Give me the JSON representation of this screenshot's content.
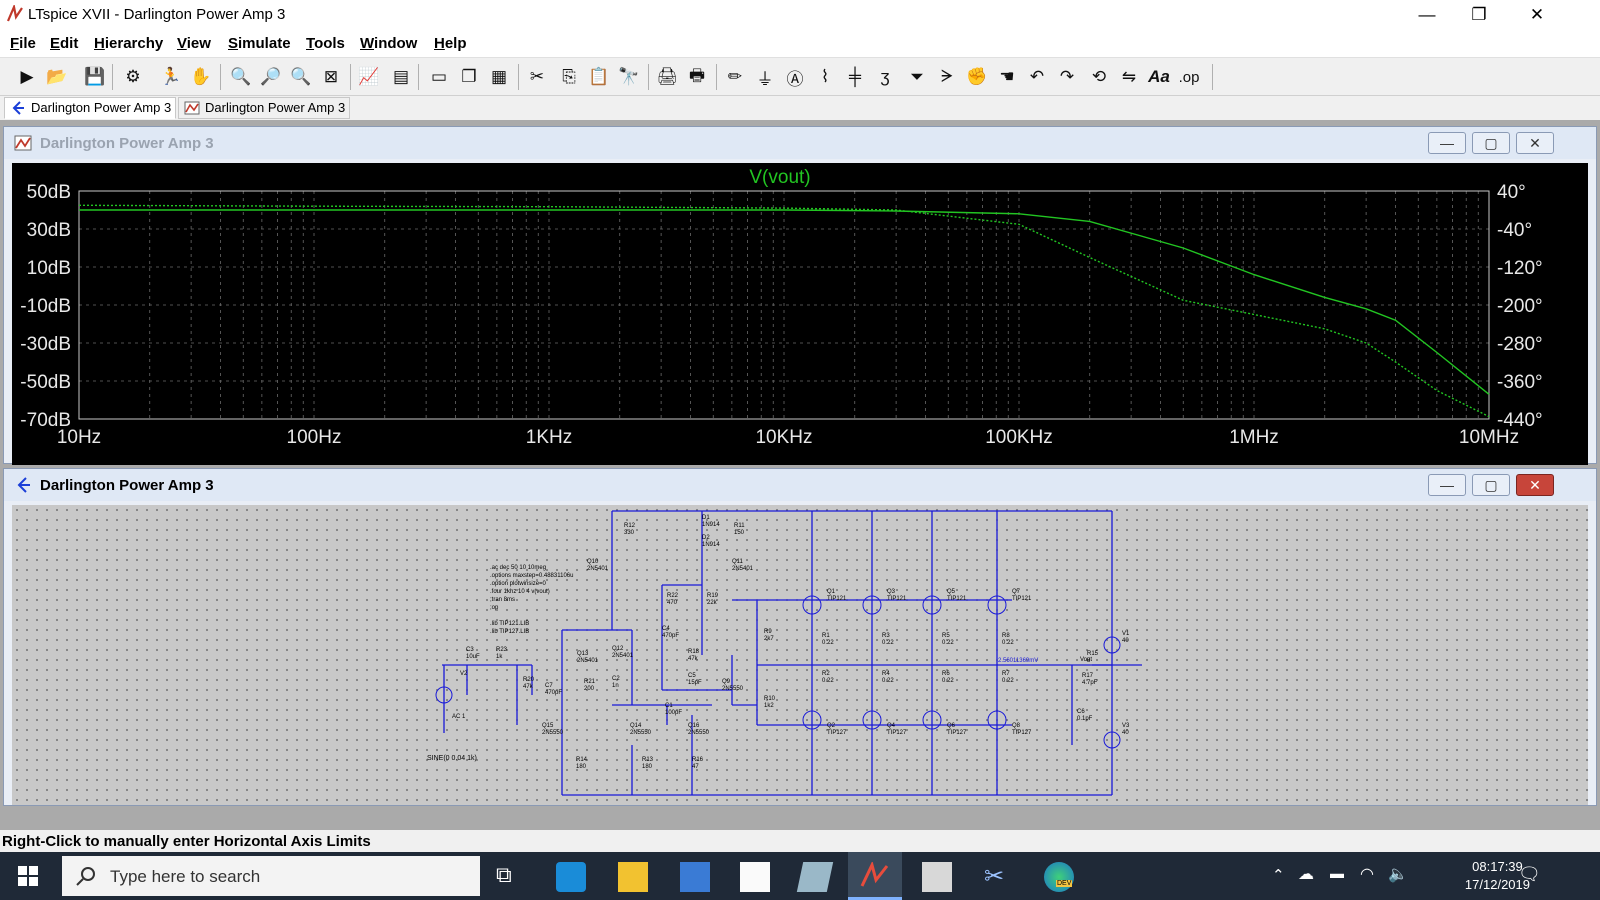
{
  "window": {
    "title": "LTspice XVII - Darlington Power Amp 3",
    "minimize": "—",
    "maximize": "❐",
    "close": "✕"
  },
  "menu": [
    {
      "ul": "F",
      "rest": "ile"
    },
    {
      "ul": "E",
      "rest": "dit"
    },
    {
      "ul": "H",
      "rest": "ierarchy"
    },
    {
      "ul": "V",
      "rest": "iew"
    },
    {
      "ul": "S",
      "rest": "imulate"
    },
    {
      "ul": "T",
      "rest": "ools"
    },
    {
      "ul": "W",
      "rest": "indow"
    },
    {
      "ul": "H",
      "rest": "elp"
    }
  ],
  "toolbar": {
    "font_button": "Aa",
    "op_button": ".op"
  },
  "tabs": [
    {
      "label": "Darlington Power Amp 3"
    },
    {
      "label": "Darlington Power Amp 3"
    }
  ],
  "plot_window": {
    "title": "Darlington Power Amp 3"
  },
  "schematic_window": {
    "title": "Darlington Power Amp 3"
  },
  "chart_data": {
    "type": "line",
    "title": "V(vout)",
    "x_scale": "log",
    "x_ticks": [
      "10Hz",
      "100Hz",
      "1KHz",
      "10KHz",
      "100KHz",
      "1MHz",
      "10MHz"
    ],
    "y_left_ticks": [
      "50dB",
      "30dB",
      "10dB",
      "-10dB",
      "-30dB",
      "-50dB",
      "-70dB"
    ],
    "y_right_ticks": [
      "40°",
      "-40°",
      "-120°",
      "-200°",
      "-280°",
      "-360°",
      "-440°"
    ],
    "xlim": [
      10,
      10000000
    ],
    "ylim_db": [
      -70,
      50
    ],
    "ylim_phase": [
      -440,
      40
    ],
    "grid": true,
    "series": [
      {
        "name": "V(vout)",
        "axis": "magnitude",
        "style": "solid",
        "color": "#22c522",
        "x": [
          10,
          100,
          1000,
          10000,
          30000,
          100000,
          200000,
          500000,
          1000000,
          2000000,
          3000000,
          4000000,
          6000000,
          10000000
        ],
        "y": [
          40,
          40,
          40,
          40,
          39.5,
          38,
          34,
          20,
          6,
          -6,
          -12,
          -18,
          -35,
          -57
        ]
      },
      {
        "name": "V(vout) phase",
        "axis": "phase",
        "style": "dotted",
        "color": "#22c522",
        "x": [
          10,
          100,
          1000,
          10000,
          30000,
          100000,
          200000,
          500000,
          1000000,
          2000000,
          3000000,
          4000000,
          6000000,
          10000000
        ],
        "y": [
          10,
          8,
          7,
          4,
          0,
          -30,
          -100,
          -190,
          -220,
          -250,
          -280,
          -320,
          -380,
          -435
        ]
      }
    ]
  },
  "schematic": {
    "directives": [
      ".ac dec 50 10 10meg",
      ".options maxstep=0.48831106u",
      ".option plotwinsize=0",
      ".four 1khz 10 4 v(vout)",
      ";tran 8ms",
      ";op",
      ".lib TIP121.LIB",
      ".lib TIP127.LIB"
    ],
    "source_label": "SINE(0 0.04 1k)",
    "ac_label": "AC 1",
    "vout_label": "Vout",
    "node_voltage": "2.56011369mV",
    "labels": [
      {
        "t": "R12",
        "v": "330"
      },
      {
        "t": "R11",
        "v": "150"
      },
      {
        "t": "D1",
        "v": "1N914"
      },
      {
        "t": "D2",
        "v": "1N914"
      },
      {
        "t": "Q10",
        "v": "2N5401"
      },
      {
        "t": "Q11",
        "v": "2N5401"
      },
      {
        "t": "R22",
        "v": "470"
      },
      {
        "t": "R19",
        "v": "22k"
      },
      {
        "t": "C4",
        "v": "470pF"
      },
      {
        "t": "R18",
        "v": "47k"
      },
      {
        "t": "C5",
        "v": "15pF"
      },
      {
        "t": "Q9",
        "v": "2N5550"
      },
      {
        "t": "R9",
        "v": "2k7"
      },
      {
        "t": "R10",
        "v": "1k2"
      },
      {
        "t": "Q13",
        "v": "2N5401"
      },
      {
        "t": "Q12",
        "v": "2N5401"
      },
      {
        "t": "R21",
        "v": "200"
      },
      {
        "t": "C2",
        "v": "1n"
      },
      {
        "t": "C3",
        "v": "10uF"
      },
      {
        "t": "R23",
        "v": "1k"
      },
      {
        "t": "R20",
        "v": "47k"
      },
      {
        "t": "C7",
        "v": "470pF"
      },
      {
        "t": "C1",
        "v": "100pF"
      },
      {
        "t": "Q15",
        "v": "2N5550"
      },
      {
        "t": "Q14",
        "v": "2N5550"
      },
      {
        "t": "Q16",
        "v": "2N5550"
      },
      {
        "t": "R14",
        "v": "180"
      },
      {
        "t": "R13",
        "v": "180"
      },
      {
        "t": "R16",
        "v": "47"
      },
      {
        "t": "V2",
        "v": ""
      },
      {
        "t": "Q1",
        "v": "TIP121"
      },
      {
        "t": "Q3",
        "v": "TIP121"
      },
      {
        "t": "Q5",
        "v": "TIP121"
      },
      {
        "t": "Q7",
        "v": "TIP121"
      },
      {
        "t": "R1",
        "v": "0.22"
      },
      {
        "t": "R3",
        "v": "0.22"
      },
      {
        "t": "R5",
        "v": "0.22"
      },
      {
        "t": "R8",
        "v": "0.22"
      },
      {
        "t": "R2",
        "v": "0.22"
      },
      {
        "t": "R4",
        "v": "0.22"
      },
      {
        "t": "R6",
        "v": "0.22"
      },
      {
        "t": "R7",
        "v": "0.22"
      },
      {
        "t": "Q2",
        "v": "TIP127"
      },
      {
        "t": "Q4",
        "v": "TIP127"
      },
      {
        "t": "Q6",
        "v": "TIP127"
      },
      {
        "t": "Q8",
        "v": "TIP127"
      },
      {
        "t": "R15",
        "v": "8"
      },
      {
        "t": "R17",
        "v": "4.7pF"
      },
      {
        "t": "C6",
        "v": "0.1pF"
      },
      {
        "t": "V1",
        "v": "40"
      },
      {
        "t": "V3",
        "v": "40"
      }
    ]
  },
  "status": {
    "text": "Right-Click to manually enter Horizontal Axis Limits"
  },
  "taskbar": {
    "search_placeholder": "Type here to search",
    "time": "08:17:39",
    "date": "17/12/2019",
    "edge_badge": "DEV"
  }
}
